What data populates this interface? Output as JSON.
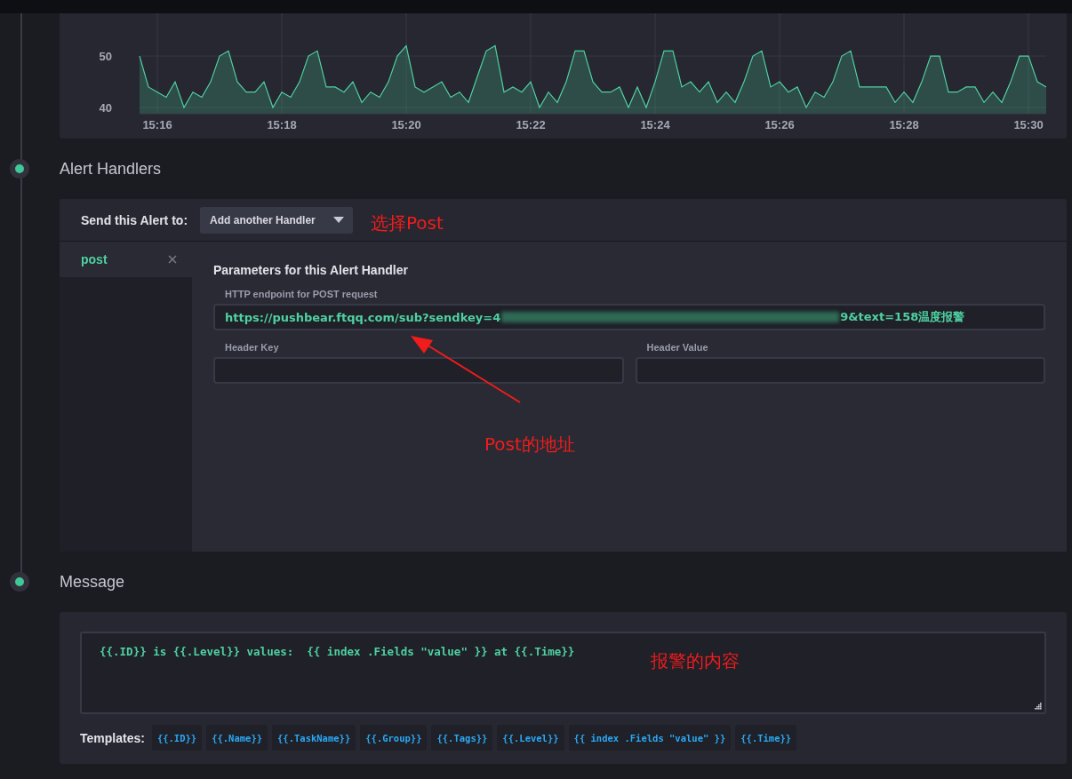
{
  "chart": {
    "chart_data": {
      "type": "area",
      "grid": true,
      "ylim": [
        38.8,
        58.3
      ],
      "yticks": [
        40,
        50
      ],
      "categories": [
        null,
        null,
        "15:16",
        null,
        null,
        null,
        null,
        null,
        null,
        null,
        null,
        null,
        null,
        null,
        null,
        null,
        "15:18",
        null,
        null,
        null,
        null,
        null,
        null,
        null,
        null,
        null,
        null,
        null,
        null,
        null,
        "15:20",
        null,
        null,
        null,
        null,
        null,
        null,
        null,
        null,
        null,
        null,
        null,
        null,
        null,
        "15:22",
        null,
        null,
        null,
        null,
        null,
        null,
        null,
        null,
        null,
        null,
        null,
        null,
        null,
        "15:24",
        null,
        null,
        null,
        null,
        null,
        null,
        null,
        null,
        null,
        null,
        null,
        null,
        null,
        "15:26",
        null,
        null,
        null,
        null,
        null,
        null,
        null,
        null,
        null,
        null,
        null,
        null,
        null,
        "15:28",
        null,
        null,
        null,
        null,
        null,
        null,
        null,
        null,
        null,
        null,
        null,
        null,
        null,
        "15:30",
        null,
        null
      ],
      "series": [
        {
          "color": "#4fd1a1",
          "values": [
            50,
            44,
            43,
            42,
            45,
            40,
            43,
            42,
            45,
            50,
            51,
            45,
            43,
            43,
            45,
            40,
            43,
            42,
            45,
            50,
            51,
            44,
            44,
            43,
            45,
            41,
            43,
            42,
            45,
            50,
            52,
            44,
            43,
            44,
            45,
            42,
            43,
            41,
            46,
            51,
            52,
            43,
            44,
            43,
            45,
            40,
            43,
            41,
            45,
            51,
            51,
            45,
            43,
            43,
            44,
            40,
            44,
            40,
            45,
            51,
            51,
            44,
            45,
            43,
            45,
            41,
            43,
            41,
            45,
            50,
            51,
            44,
            45,
            43,
            44,
            40,
            43,
            42,
            45,
            50,
            51,
            44,
            44,
            44,
            44,
            41,
            43,
            41,
            45,
            50,
            50,
            43,
            43,
            44,
            44,
            41,
            43,
            41,
            45,
            50,
            50,
            45,
            44
          ]
        }
      ]
    }
  },
  "handlers_section": {
    "title": "Alert Handlers",
    "send_label": "Send this Alert to:",
    "dropdown": {
      "label": "Add another Handler",
      "note": {
        "kind": "label",
        "text": "选择Post"
      }
    },
    "handlers": [
      {
        "label": "post",
        "selected": true
      }
    ],
    "parameters_title": "Parameters for this Alert Handler",
    "endpoint": {
      "label": "HTTP endpoint for POST request",
      "value_start": "https://pushbear.ftqq.com/sub?sendkey=4",
      "value_end": "9&text=158温度报警",
      "redacted": true,
      "note": {
        "kind": "arrow",
        "text": "Post的地址"
      }
    },
    "header_key": {
      "label": "Header Key"
    },
    "header_value": {
      "label": "Header Value"
    }
  },
  "message_section": {
    "title": "Message",
    "message": {
      "value": "{{.ID}} is {{.Level}} values:  {{ index .Fields \"value\" }} at {{.Time}}",
      "note": {
        "kind": "label",
        "text": "报警的内容"
      }
    },
    "templates_label": "Templates:",
    "templates": [
      "{{.ID}}",
      "{{.Name}}",
      "{{.TaskName}}",
      "{{.Group}}",
      "{{.Tags}}",
      "{{.Level}}",
      "{{ index .Fields \"value\" }}",
      "{{.Time}}"
    ]
  }
}
